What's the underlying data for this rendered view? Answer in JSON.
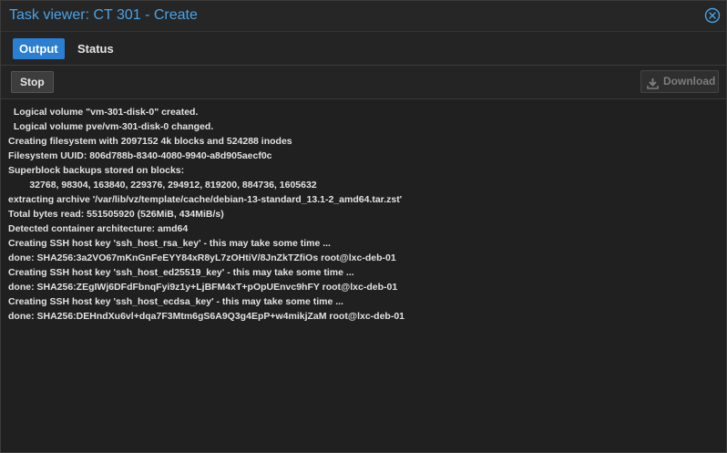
{
  "window": {
    "title": "Task viewer: CT 301 - Create",
    "close_icon": "close-circle-icon"
  },
  "tabs": [
    {
      "label": "Output",
      "active": true
    },
    {
      "label": "Status",
      "active": false
    }
  ],
  "toolbar": {
    "stop_label": "Stop",
    "download_label": "Download",
    "download_icon": "download-icon",
    "download_enabled": false
  },
  "log_lines": [
    "  Logical volume \"vm-301-disk-0\" created.",
    "  Logical volume pve/vm-301-disk-0 changed.",
    "Creating filesystem with 2097152 4k blocks and 524288 inodes",
    "Filesystem UUID: 806d788b-8340-4080-9940-a8d905aecf0c",
    "Superblock backups stored on blocks:",
    "\t32768, 98304, 163840, 229376, 294912, 819200, 884736, 1605632",
    "extracting archive '/var/lib/vz/template/cache/debian-13-standard_13.1-2_amd64.tar.zst'",
    "Total bytes read: 551505920 (526MiB, 434MiB/s)",
    "Detected container architecture: amd64",
    "Creating SSH host key 'ssh_host_rsa_key' - this may take some time ...",
    "done: SHA256:3a2VO67mKnGnFeEYY84xR8yL7zOHtiV/8JnZkTZfiOs root@lxc-deb-01",
    "Creating SSH host key 'ssh_host_ed25519_key' - this may take some time ...",
    "done: SHA256:ZEgIWj6DFdFbnqFyi9z1y+LjBFM4xT+pOpUEnvc9hFY root@lxc-deb-01",
    "Creating SSH host key 'ssh_host_ecdsa_key' - this may take some time ...",
    "done: SHA256:DEHndXu6vl+dqa7F3Mtm6gS6A9Q3g4EpP+w4mikjZaM root@lxc-deb-01"
  ],
  "colors": {
    "accent": "#2a7fd3",
    "title": "#4aa3e8",
    "log_text": "#e2e2e2",
    "background": "#202020"
  }
}
